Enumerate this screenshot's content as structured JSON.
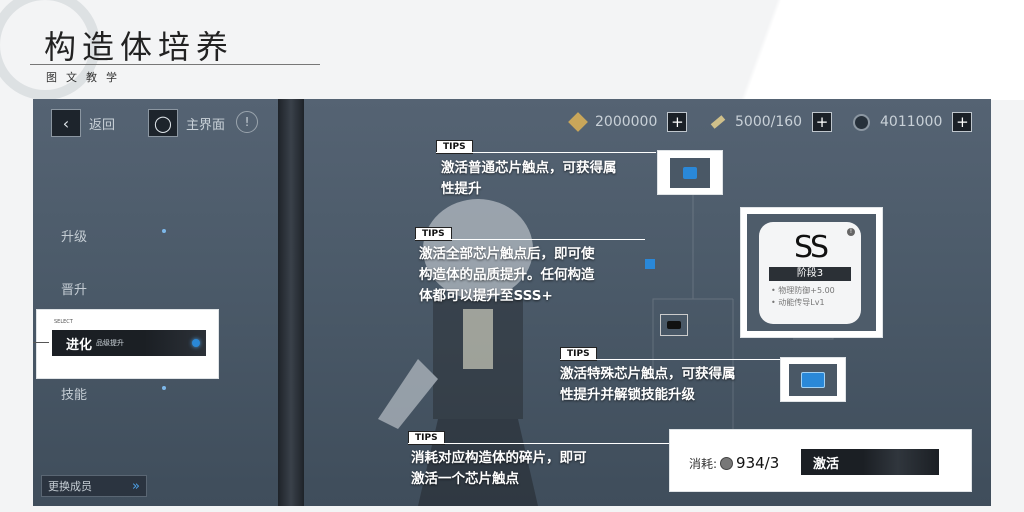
{
  "header": {
    "title": "构造体培养",
    "subtitle": "图文教学"
  },
  "topbar": {
    "back_label": "返回",
    "home_label": "主界面",
    "resources": [
      {
        "icon": "coin-icon",
        "value": "2000000"
      },
      {
        "icon": "stamina-icon",
        "value": "5000/160"
      },
      {
        "icon": "crystal-icon",
        "value": "4011000"
      }
    ]
  },
  "sidebar": {
    "items": [
      {
        "label": "升级"
      },
      {
        "label": "晋升"
      },
      {
        "label": "进化",
        "sublabel": "品级提升",
        "select_tag": "SELECT"
      },
      {
        "label": "技能"
      }
    ],
    "switch_member_label": "更换成员"
  },
  "tips": [
    {
      "tag": "TIPS",
      "text_lines": [
        "激活普通芯片触点，可获得属",
        "性提升"
      ]
    },
    {
      "tag": "TIPS",
      "text_lines": [
        "激活全部芯片触点后，即可使",
        "构造体的品质提升。任何构造",
        "体都可以提升至SSS+"
      ]
    },
    {
      "tag": "TIPS",
      "text_lines": [
        "激活特殊芯片触点，可获得属",
        "性提升并解锁技能升级"
      ]
    },
    {
      "tag": "TIPS",
      "text_lines": [
        "消耗对应构造体的碎片，即可",
        "激活一个芯片触点"
      ]
    }
  ],
  "rank_card": {
    "rank": "SS",
    "stage": "阶段3",
    "bonuses": [
      "• 物理防御+5.00",
      "• 动能传导Lv1"
    ]
  },
  "activate_panel": {
    "cost_label": "消耗:",
    "cost_value": "934/3",
    "button_label": "激活"
  },
  "colors": {
    "accent_blue": "#2a88d8",
    "game_bg": "#4f5e6d",
    "panel_dark": "#1b1f24"
  }
}
